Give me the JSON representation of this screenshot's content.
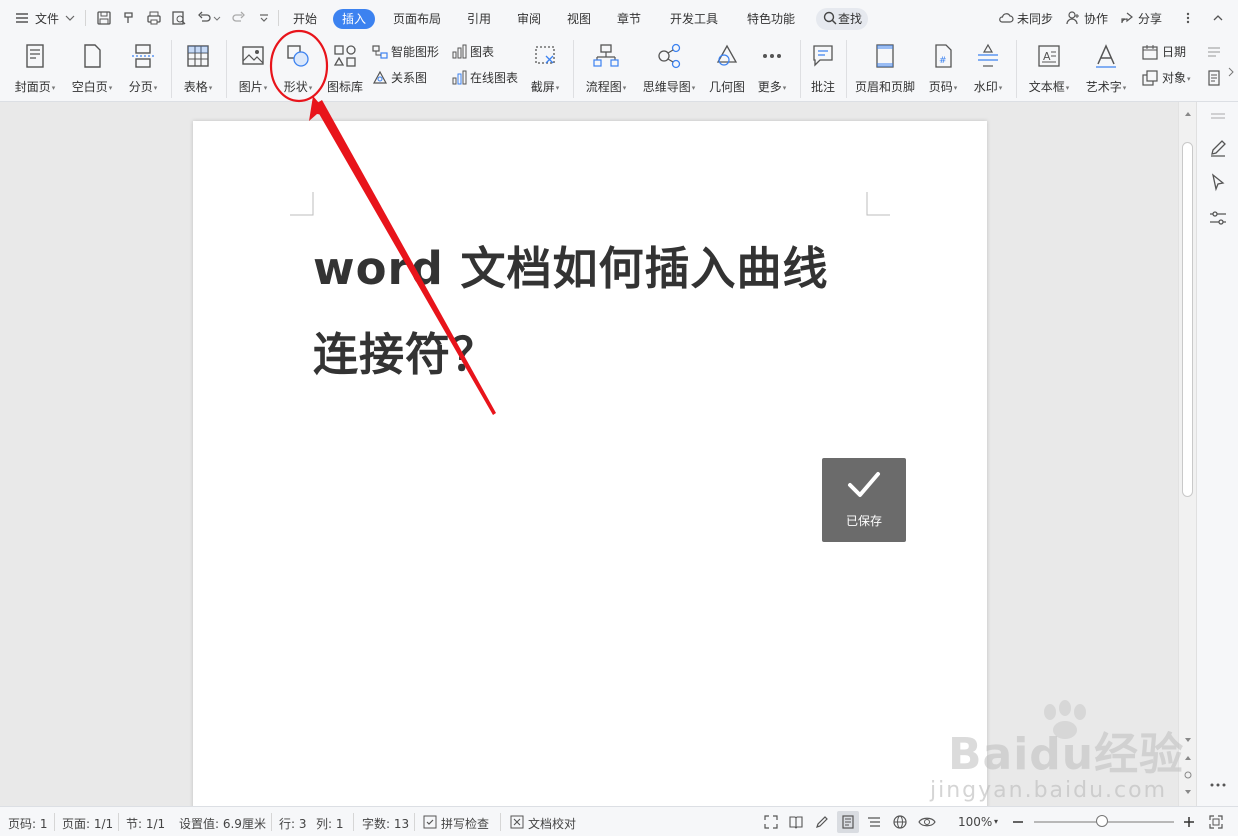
{
  "menubar": {
    "file_label": "文件",
    "tabs": [
      {
        "label": "开始"
      },
      {
        "label": "插入"
      },
      {
        "label": "页面布局"
      },
      {
        "label": "引用"
      },
      {
        "label": "审阅"
      },
      {
        "label": "视图"
      },
      {
        "label": "章节"
      },
      {
        "label": "开发工具"
      },
      {
        "label": "特色功能"
      }
    ],
    "search_label": "查找",
    "sync_label": "未同步",
    "collab_label": "协作",
    "share_label": "分享"
  },
  "ribbon": {
    "cover": "封面页",
    "blank": "空白页",
    "pagebreak": "分页",
    "table": "表格",
    "picture": "图片",
    "shape": "形状",
    "iconlib": "图标库",
    "smartart": "智能图形",
    "relation": "关系图",
    "chart": "图表",
    "onlinechart": "在线图表",
    "screenshot": "截屏",
    "flowchart": "流程图",
    "mindmap": "思维导图",
    "geometry": "几何图",
    "more": "更多",
    "comment": "批注",
    "headerfooter": "页眉和页脚",
    "pagenum": "页码",
    "watermark": "水印",
    "textbox": "文本框",
    "arttext": "艺术字",
    "date": "日期",
    "object": "对象"
  },
  "document": {
    "title_line1": "word 文档如何插入曲线",
    "title_line2": "连接符？"
  },
  "toast": {
    "text": "已保存"
  },
  "statusbar": {
    "page": "页码: 1",
    "pages": "页面: 1/1",
    "section": "节: 1/1",
    "setting": "设置值: 6.9厘米",
    "row": "行: 3",
    "col": "列: 1",
    "words": "字数: 13",
    "spellcheck": "拼写检查",
    "proofread": "文档校对",
    "zoom": "100%",
    "zoom_level_percent": 100
  },
  "watermark": {
    "brand": "Baidu经验",
    "url": "jingyan.baidu.com"
  },
  "colors": {
    "accent": "#3c82f0",
    "annotation": "#e8141b",
    "toast_bg": "#6b6b6b"
  }
}
